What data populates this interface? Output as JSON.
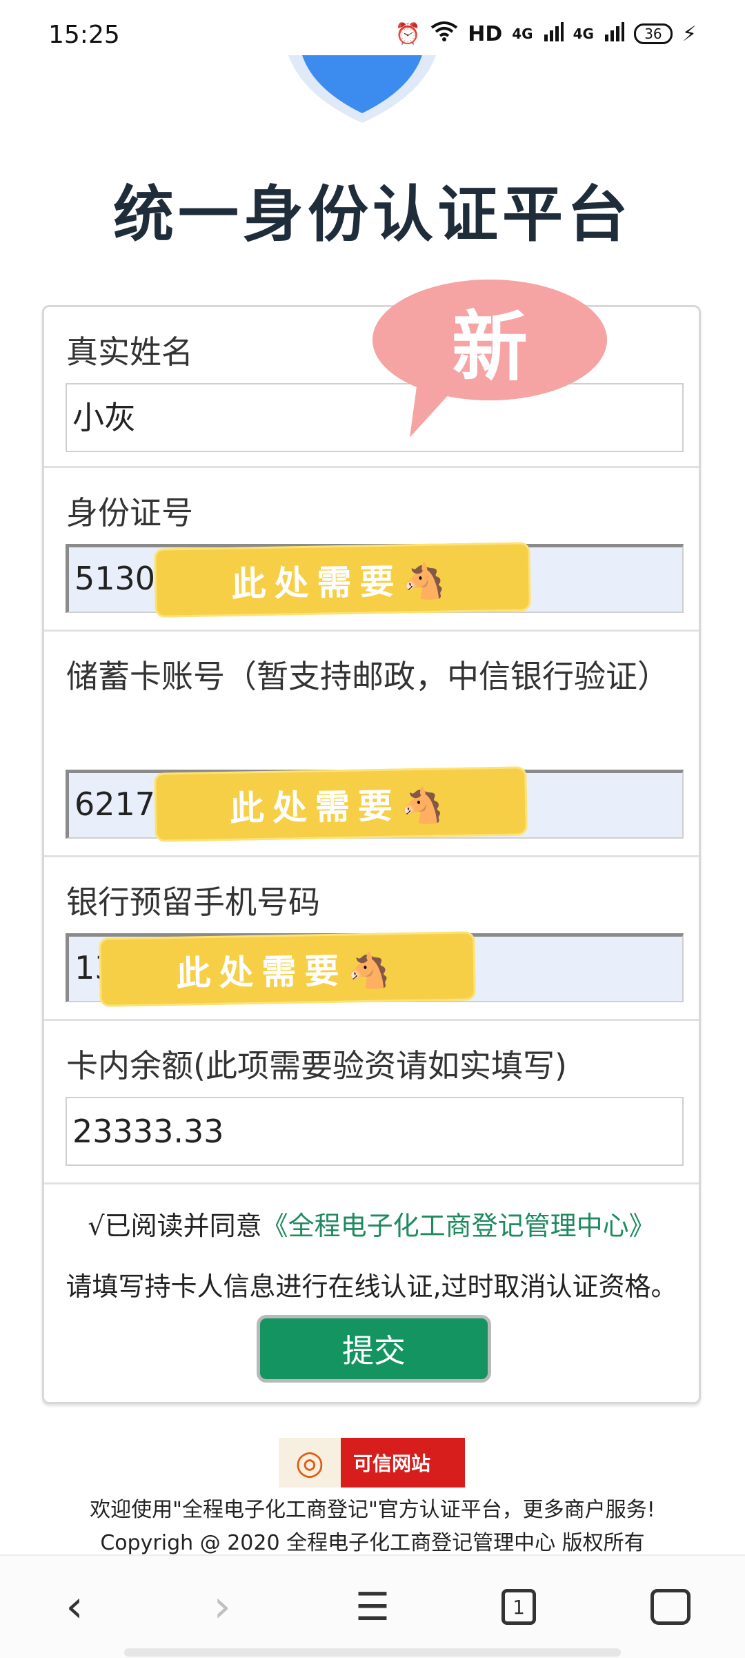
{
  "status_bar": {
    "time": "15:25",
    "hd_label": "HD",
    "net_1": "4G",
    "net_2": "4G",
    "battery": "36",
    "icons": [
      "alarm-icon",
      "wifi-icon",
      "signal-icon",
      "signal-icon",
      "battery-icon",
      "charging-icon"
    ]
  },
  "header": {
    "title": "统一身份认证平台"
  },
  "form": {
    "name": {
      "label": "真实姓名",
      "value": "小灰"
    },
    "id_number": {
      "label": "身份证号",
      "value": "51302"
    },
    "card_number": {
      "label": "储蓄卡账号（暂支持邮政，中信银行验证）",
      "value": "62175"
    },
    "phone": {
      "label": "银行预留手机号码",
      "value": "13"
    },
    "balance": {
      "label": "卡内余额(此项需要验资请如实填写)",
      "value": "23333.33"
    },
    "agree_prefix": "√已阅读并同意",
    "agree_link": "《全程电子化工商登记管理中心》",
    "notice": "请填写持卡人信息进行在线认证,过时取消认证资格。",
    "submit_label": "提交"
  },
  "overlays": {
    "new_badge": "新",
    "sticker_text": "此处需要🐴"
  },
  "footer": {
    "trust_badge": "可信网站",
    "welcome": "欢迎使用\"全程电子化工商登记\"官方认证平台，更多商户服务!",
    "copyright": "Copyrigh @ 2020 全程电子化工商登记管理中心 版权所有"
  },
  "nav": {
    "back": "‹",
    "forward": "›",
    "menu": "☰",
    "tabs_count": "1"
  },
  "colors": {
    "accent_green": "#139460",
    "link_green": "#1f8a5e",
    "sticker_yellow": "#f6cf47",
    "badge_pink": "#f5a3a3",
    "shield_blue": "#3c8cf0"
  }
}
